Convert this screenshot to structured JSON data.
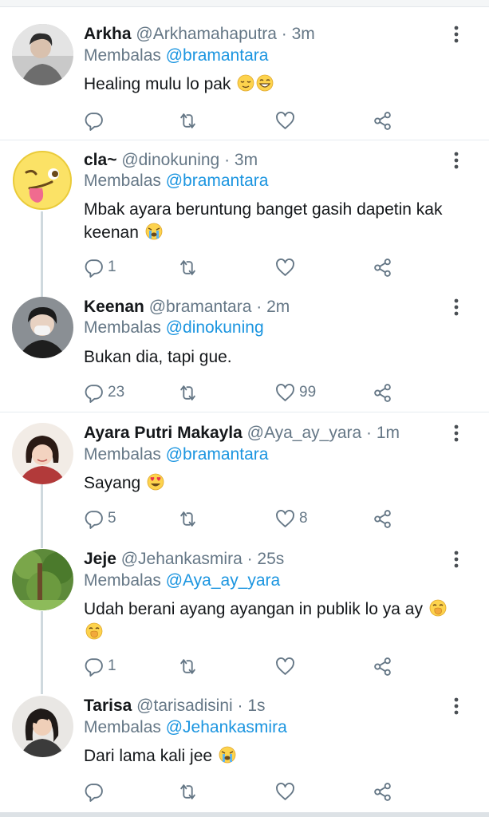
{
  "tweets": [
    {
      "name": "Arkha",
      "handle": "@Arkhamahaputra",
      "time": "· 3m",
      "reply_prefix": "Membalas",
      "reply_to": "@bramantara",
      "text": "Healing mulu lo pak",
      "emojis": [
        "relieved-face-emoji",
        "grinning-face-emoji"
      ],
      "replies": "",
      "likes": ""
    },
    {
      "name": "cla~",
      "handle": "@dinokuning",
      "time": "· 3m",
      "reply_prefix": "Membalas",
      "reply_to": "@bramantara",
      "text": "Mbak ayara beruntung banget gasih dapetin kak keenan",
      "emojis": [
        "loudly-crying-face-emoji"
      ],
      "replies": "1",
      "likes": ""
    },
    {
      "name": "Keenan",
      "handle": "@bramantara",
      "time": "· 2m",
      "reply_prefix": "Membalas",
      "reply_to": "@dinokuning",
      "text": "Bukan dia, tapi gue.",
      "emojis": [],
      "replies": "23",
      "likes": "99"
    },
    {
      "name": "Ayara Putri Makayla",
      "handle": "@Aya_ay_yara",
      "time": "· 1m",
      "reply_prefix": "Membalas",
      "reply_to": "@bramantara",
      "text": "Sayang",
      "emojis": [
        "heart-eyes-emoji"
      ],
      "replies": "5",
      "likes": "8"
    },
    {
      "name": "Jeje",
      "handle": "@Jehankasmira",
      "time": "· 25s",
      "reply_prefix": "Membalas",
      "reply_to": "@Aya_ay_yara",
      "text": "Udah berani ayang ayangan in publik lo ya ay",
      "emojis": [
        "hand-over-mouth-emoji",
        "hand-over-mouth-emoji"
      ],
      "replies": "1",
      "likes": ""
    },
    {
      "name": "Tarisa",
      "handle": "@tarisadisini",
      "time": "· 1s",
      "reply_prefix": "Membalas",
      "reply_to": "@Jehankasmira",
      "text": "Dari lama kali jee",
      "emojis": [
        "loudly-crying-face-emoji"
      ],
      "replies": "",
      "likes": ""
    }
  ],
  "icons": {
    "reply": "reply-icon",
    "retweet": "retweet-icon",
    "like": "heart-icon",
    "share": "share-icon",
    "more": "more-vertical-icon"
  },
  "colors": {
    "name": "#14171a",
    "secondary": "#657786",
    "mention": "#1b95e0",
    "divider": "#e6ecf0",
    "thread_line": "#cfd9de"
  }
}
